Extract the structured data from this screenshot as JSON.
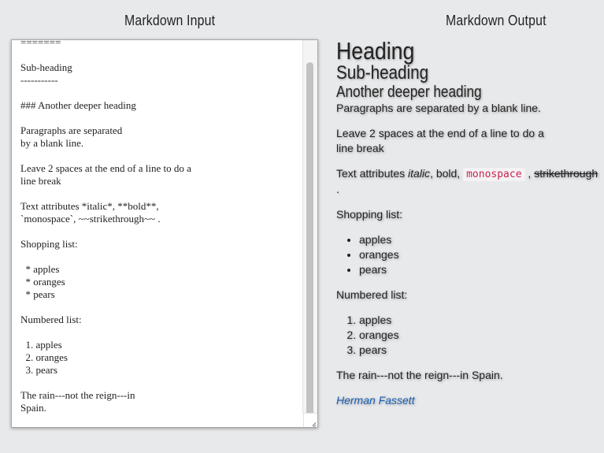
{
  "input_panel": {
    "title": "Markdown Input",
    "text": "=======\n\nSub-heading\n-----------\n\n### Another deeper heading\n\nParagraphs are separated\nby a blank line.\n\nLeave 2 spaces at the end of a line to do a\nline break\n\nText attributes *italic*, **bold**,\n`monospace`, ~~strikethrough~~ .\n\nShopping list:\n\n  * apples\n  * oranges\n  * pears\n\nNumbered list:\n\n  1. apples\n  2. oranges\n  3. pears\n\nThe rain---not the reign---in\nSpain."
  },
  "output_panel": {
    "title": "Markdown Output",
    "h1": "Heading",
    "h2": "Sub-heading",
    "h3": "Another deeper heading",
    "para1": "Paragraphs are separated by a blank line.",
    "para2_line1": "Leave 2 spaces at the end of a line to do a",
    "para2_line2": "line break",
    "attrs_prefix": "Text attributes ",
    "attrs_italic": "italic",
    "attrs_bold_part": ", bold, ",
    "attrs_mono": "monospace",
    "attrs_sep": " , ",
    "attrs_strike": "strikethrough",
    "attrs_end": " .",
    "shopping_label": "Shopping list:",
    "shopping_items": [
      "apples",
      "oranges",
      "pears"
    ],
    "numbered_label": "Numbered list:",
    "numbered_items": [
      "apples",
      "oranges",
      "pears"
    ],
    "rain": "The rain---not the reign---in Spain.",
    "author_link": "Herman Fassett"
  },
  "colors": {
    "background": "#e8e9eb",
    "code_text": "#c7254e",
    "link": "#1a5fb4"
  }
}
